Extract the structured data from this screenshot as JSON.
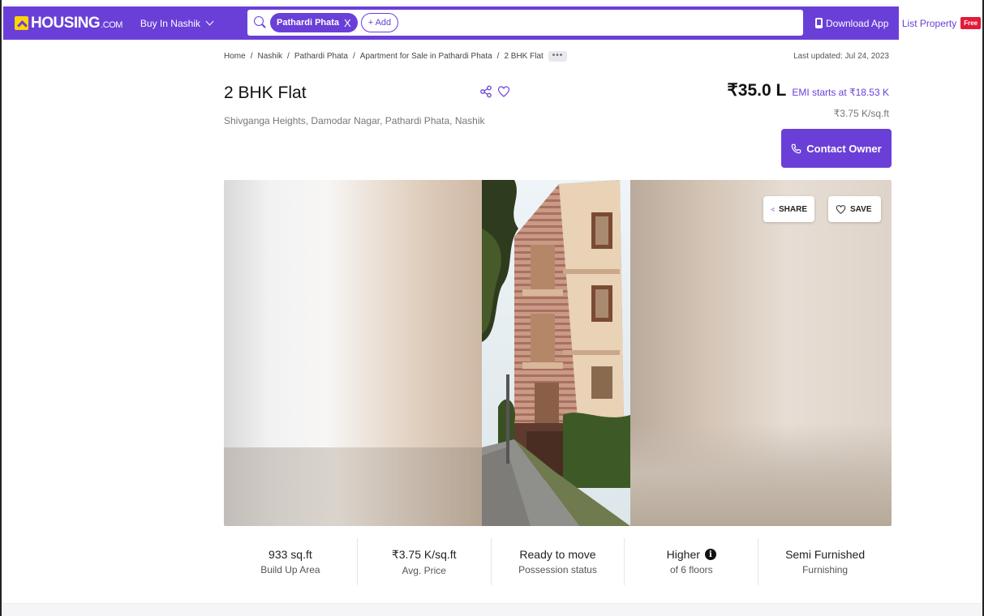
{
  "header": {
    "logo_text": "HOUSING",
    "logo_suffix": ".COM",
    "city_menu": "Buy In Nashik",
    "search_chip": "Pathardi Phata",
    "search_chip_close": "X",
    "add_chip": "+ Add",
    "download_app": "Download App",
    "list_property": "List Property",
    "free_badge": "Free"
  },
  "breadcrumb": [
    "Home",
    "Nashik",
    "Pathardi Phata",
    "Apartment for Sale in Pathardi Phata",
    "2 BHK Flat"
  ],
  "breadcrumb_more": "•••",
  "last_updated": "Last updated: Jul 24, 2023",
  "listing": {
    "title": "2 BHK Flat",
    "address": "Shivganga Heights, Damodar Nagar, Pathardi Phata, Nashik",
    "price": "₹35.0 L",
    "emi": "EMI starts at ₹18.53 K",
    "price_per_sqft": "₹3.75 K/sq.ft",
    "contact_label": "Contact Owner"
  },
  "gallery": {
    "share_label": "SHARE",
    "save_label": "SAVE"
  },
  "stats": [
    {
      "value": "933 sq.ft",
      "label": "Build Up Area"
    },
    {
      "value": "₹3.75 K/sq.ft",
      "label": "Avg. Price"
    },
    {
      "value": "Ready to move",
      "label": "Possession status"
    },
    {
      "value": "Higher",
      "label": "of 6 floors"
    },
    {
      "value": "Semi Furnished",
      "label": "Furnishing"
    }
  ],
  "colors": {
    "brand": "#6a3fd8",
    "logo_yellow": "#ffd400",
    "free_red": "#e21b3c"
  },
  "icons": [
    "search-icon",
    "close-icon",
    "phone-icon",
    "share-icon",
    "heart-icon",
    "call-icon",
    "info-icon",
    "chevron-down-icon"
  ]
}
